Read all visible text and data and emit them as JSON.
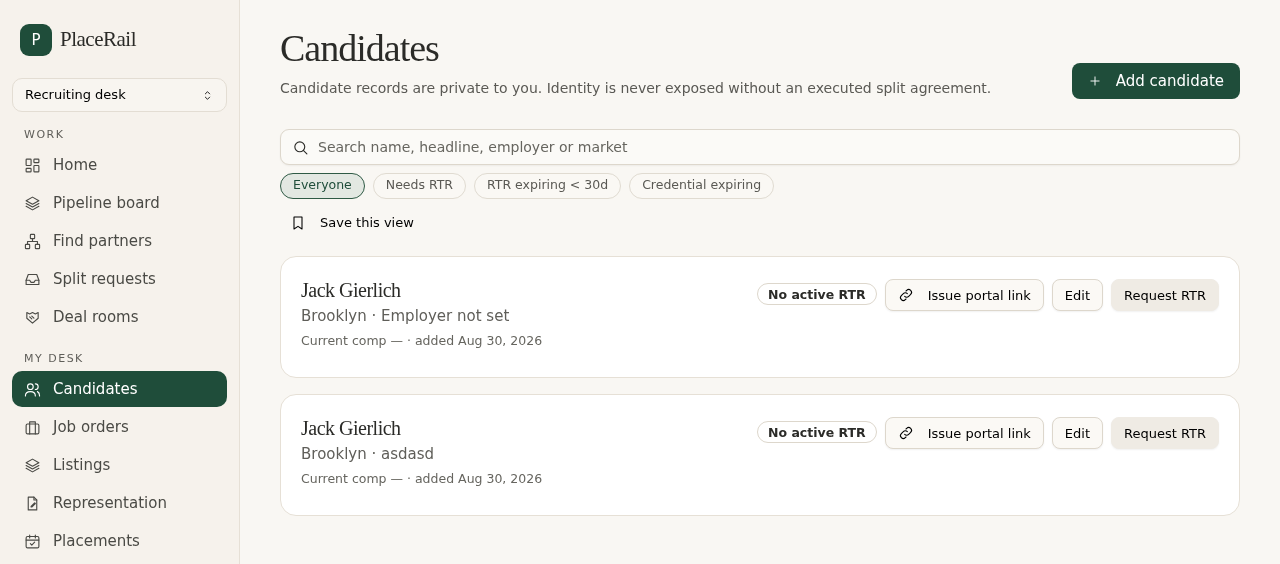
{
  "brand": {
    "initial": "P",
    "name": "PlaceRail"
  },
  "workspace": {
    "value": "Recruiting desk"
  },
  "nav_sections": [
    {
      "heading": "WORK",
      "items": [
        {
          "label": "Home",
          "selected": false
        },
        {
          "label": "Pipeline board",
          "selected": false
        },
        {
          "label": "Find partners",
          "selected": false
        },
        {
          "label": "Split requests",
          "selected": false
        },
        {
          "label": "Deal rooms",
          "selected": false
        }
      ]
    },
    {
      "heading": "MY DESK",
      "items": [
        {
          "label": "Candidates",
          "selected": true
        },
        {
          "label": "Job orders",
          "selected": false
        },
        {
          "label": "Listings",
          "selected": false
        },
        {
          "label": "Representation",
          "selected": false
        },
        {
          "label": "Placements",
          "selected": false
        }
      ]
    }
  ],
  "page": {
    "title": "Candidates",
    "subtitle": "Candidate records are private to you. Identity is never exposed without an executed split agreement.",
    "add_button": "Add candidate"
  },
  "search": {
    "placeholder": "Search name, headline, employer or market"
  },
  "filters": [
    {
      "label": "Everyone",
      "selected": true
    },
    {
      "label": "Needs RTR",
      "selected": false
    },
    {
      "label": "RTR expiring < 30d",
      "selected": false
    },
    {
      "label": "Credential expiring",
      "selected": false
    }
  ],
  "save_view": "Save this view",
  "candidates": [
    {
      "name": "Jack Gierlich",
      "location_line": "Brooklyn · Employer not set",
      "meta": "Current comp — · added Aug 30, 2026",
      "status": "No active RTR",
      "actions": [
        "Issue portal link",
        "Edit",
        "Request RTR"
      ]
    },
    {
      "name": "Jack Gierlich",
      "location_line": "Brooklyn · asdasd",
      "meta": "Current comp — · added Aug 30, 2026",
      "status": "No active RTR",
      "actions": [
        "Issue portal link",
        "Edit",
        "Request RTR"
      ]
    }
  ]
}
